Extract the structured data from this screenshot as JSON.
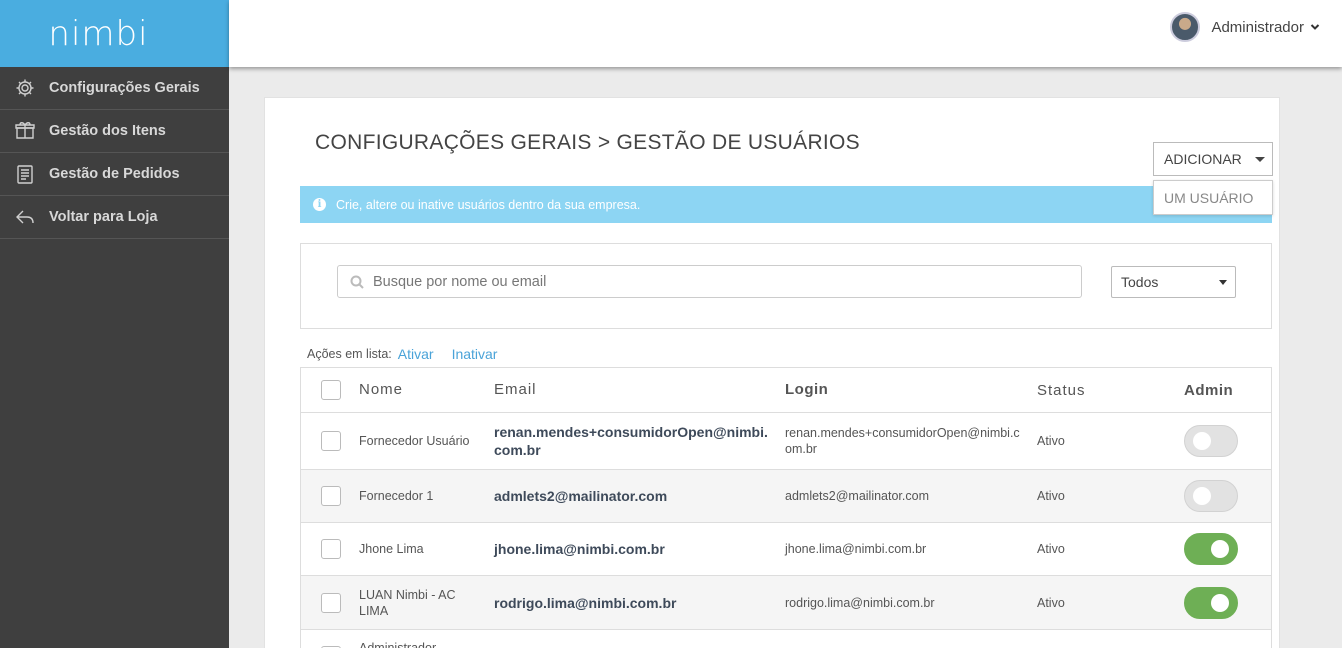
{
  "brand": {
    "logo": "nimbi",
    "color": "#4aade0"
  },
  "sidebar": {
    "items": [
      {
        "label": "Configurações Gerais",
        "icon": "gear-icon"
      },
      {
        "label": "Gestão dos Itens",
        "icon": "box-icon"
      },
      {
        "label": "Gestão de Pedidos",
        "icon": "clipboard-icon"
      },
      {
        "label": "Voltar para Loja",
        "icon": "reply-arrow-icon"
      }
    ]
  },
  "header": {
    "user_name": "Administrador"
  },
  "page": {
    "title": "CONFIGURAÇÕES GERAIS > GESTÃO DE USUÁRIOS",
    "add_button": "ADICIONAR",
    "add_menu": [
      "UM USUÁRIO"
    ],
    "alert": "Crie, altere ou inative usuários dentro da sua empresa.",
    "search": {
      "placeholder": "Busque por nome ou email",
      "value": ""
    },
    "filter": {
      "selected": "Todos"
    },
    "bulk_actions": {
      "label": "Ações em lista:",
      "activate": "Ativar",
      "deactivate": "Inativar"
    }
  },
  "table": {
    "columns": {
      "name": "Nome",
      "email": "Email",
      "login": "Login",
      "status": "Status",
      "admin": "Admin"
    },
    "rows": [
      {
        "name": "Fornecedor Usuário",
        "email": "renan.mendes+consumidorOpen@nimbi.com.br",
        "login": "renan.mendes+consumidorOpen@nimbi.com.br",
        "status": "Ativo",
        "admin": false
      },
      {
        "name": "Fornecedor 1",
        "email": "admlets2@mailinator.com",
        "login": "admlets2@mailinator.com",
        "status": "Ativo",
        "admin": false
      },
      {
        "name": "Jhone Lima",
        "email": "jhone.lima@nimbi.com.br",
        "login": "jhone.lima@nimbi.com.br",
        "status": "Ativo",
        "admin": true
      },
      {
        "name": "LUAN Nimbi - AC LIMA",
        "email": "rodrigo.lima@nimbi.com.br",
        "login": "rodrigo.lima@nimbi.com.br",
        "status": "Ativo",
        "admin": true
      },
      {
        "name": "Administrador",
        "email": "",
        "login": "",
        "status": "",
        "admin": null
      }
    ]
  },
  "colors": {
    "toggle_on": "#6eaf55",
    "alert_bg": "#8dd5f3",
    "link": "#4aa3d8",
    "sidebar_bg": "#3f3f3f"
  }
}
